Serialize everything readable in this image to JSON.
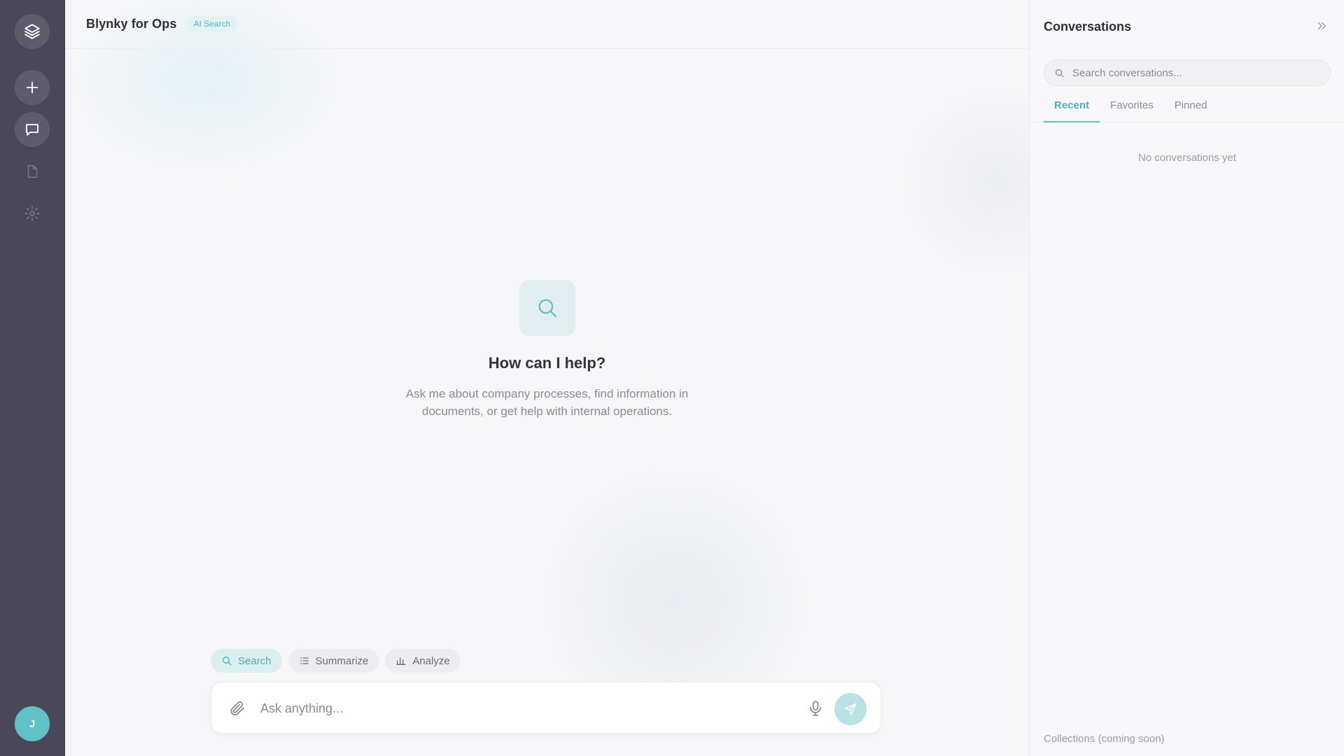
{
  "header": {
    "app_title": "Blynky for Ops",
    "badge": "AI Search"
  },
  "sidebar": {
    "items": [
      {
        "name": "logo",
        "icon": "layers-icon"
      },
      {
        "name": "new-chat",
        "icon": "plus-icon"
      },
      {
        "name": "chats",
        "icon": "chat-bubble-icon"
      },
      {
        "name": "documents",
        "icon": "document-icon"
      },
      {
        "name": "settings",
        "icon": "sun-gear-icon"
      }
    ],
    "avatar_initial": "J"
  },
  "welcome": {
    "title": "How can I help?",
    "subtitle": "Ask me about company processes, find information in documents, or get help with internal operations."
  },
  "modes": [
    {
      "label": "Search",
      "icon": "search-icon",
      "active": true
    },
    {
      "label": "Summarize",
      "icon": "list-icon",
      "active": false
    },
    {
      "label": "Analyze",
      "icon": "bar-chart-icon",
      "active": false
    }
  ],
  "composer": {
    "placeholder": "Ask anything...",
    "value": ""
  },
  "conversations": {
    "title": "Conversations",
    "search_placeholder": "Search conversations...",
    "tabs": [
      {
        "label": "Recent",
        "active": true
      },
      {
        "label": "Favorites",
        "active": false
      },
      {
        "label": "Pinned",
        "active": false
      }
    ],
    "empty_text": "No conversations yet",
    "footer": "Collections (coming soon)"
  },
  "colors": {
    "accent": "#5fc2c6",
    "rail": "#4a4858",
    "background": "#f6f6f9"
  }
}
